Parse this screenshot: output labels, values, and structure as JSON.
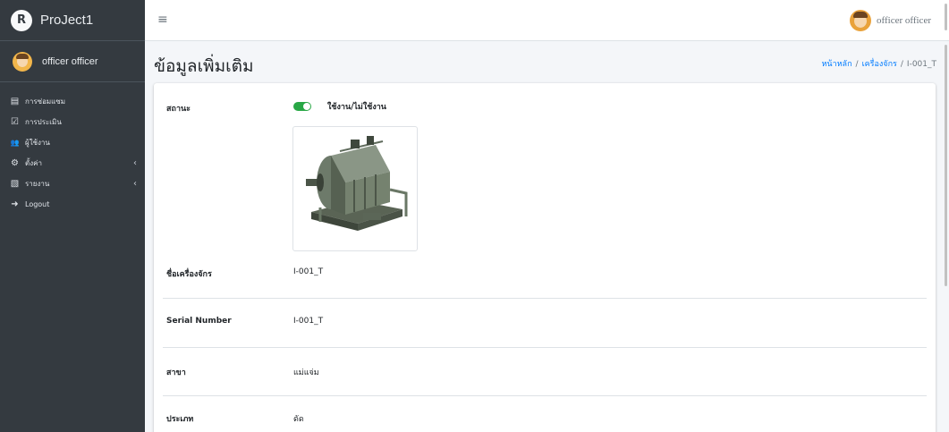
{
  "brand": {
    "title": "ProJect1",
    "logo_letter": "R"
  },
  "sidebar": {
    "user_name": "officer officer",
    "items": [
      {
        "icon": "file-icon",
        "glyph": "▤",
        "label": "การซ่อมแซม",
        "has_chevron": false
      },
      {
        "icon": "check-square-icon",
        "glyph": "☑",
        "label": "การประเมิน",
        "has_chevron": false
      },
      {
        "icon": "users-icon",
        "glyph": "👥",
        "label": "ผู้ใช้งาน",
        "has_chevron": false
      },
      {
        "icon": "gear-icon",
        "glyph": "⚙",
        "label": "ตั้งค่า",
        "has_chevron": true
      },
      {
        "icon": "pdf-file-icon",
        "glyph": "▧",
        "label": "รายงาน",
        "has_chevron": true
      },
      {
        "icon": "logout-icon",
        "glyph": "➜",
        "label": "Logout",
        "has_chevron": false
      }
    ],
    "chevron": "‹"
  },
  "topbar": {
    "menu_glyph": "≡",
    "user_name": "officer officer"
  },
  "header": {
    "title": "ข้อมูลเพิ่มเติม",
    "breadcrumb": {
      "home": "หน้าหลัก",
      "parent": "เครื่องจักร",
      "current": "I-001_T",
      "sep": "/"
    }
  },
  "details": {
    "status_label": "สถานะ",
    "status_toggle_text": "ใช้งาน/ไม่ใช้งาน",
    "status_on": true,
    "rows": [
      {
        "label": "ชื่อเครื่องจักร",
        "value": "I-001_T"
      },
      {
        "label": "Serial Number",
        "value": "I-001_T"
      },
      {
        "label": "สาขา",
        "value": "แม่แจ่ม"
      },
      {
        "label": "ประเภท",
        "value": "ดัด"
      }
    ]
  },
  "colors": {
    "sidebar_bg": "#343a40",
    "accent": "#007bff",
    "toggle_on": "#28a745"
  }
}
